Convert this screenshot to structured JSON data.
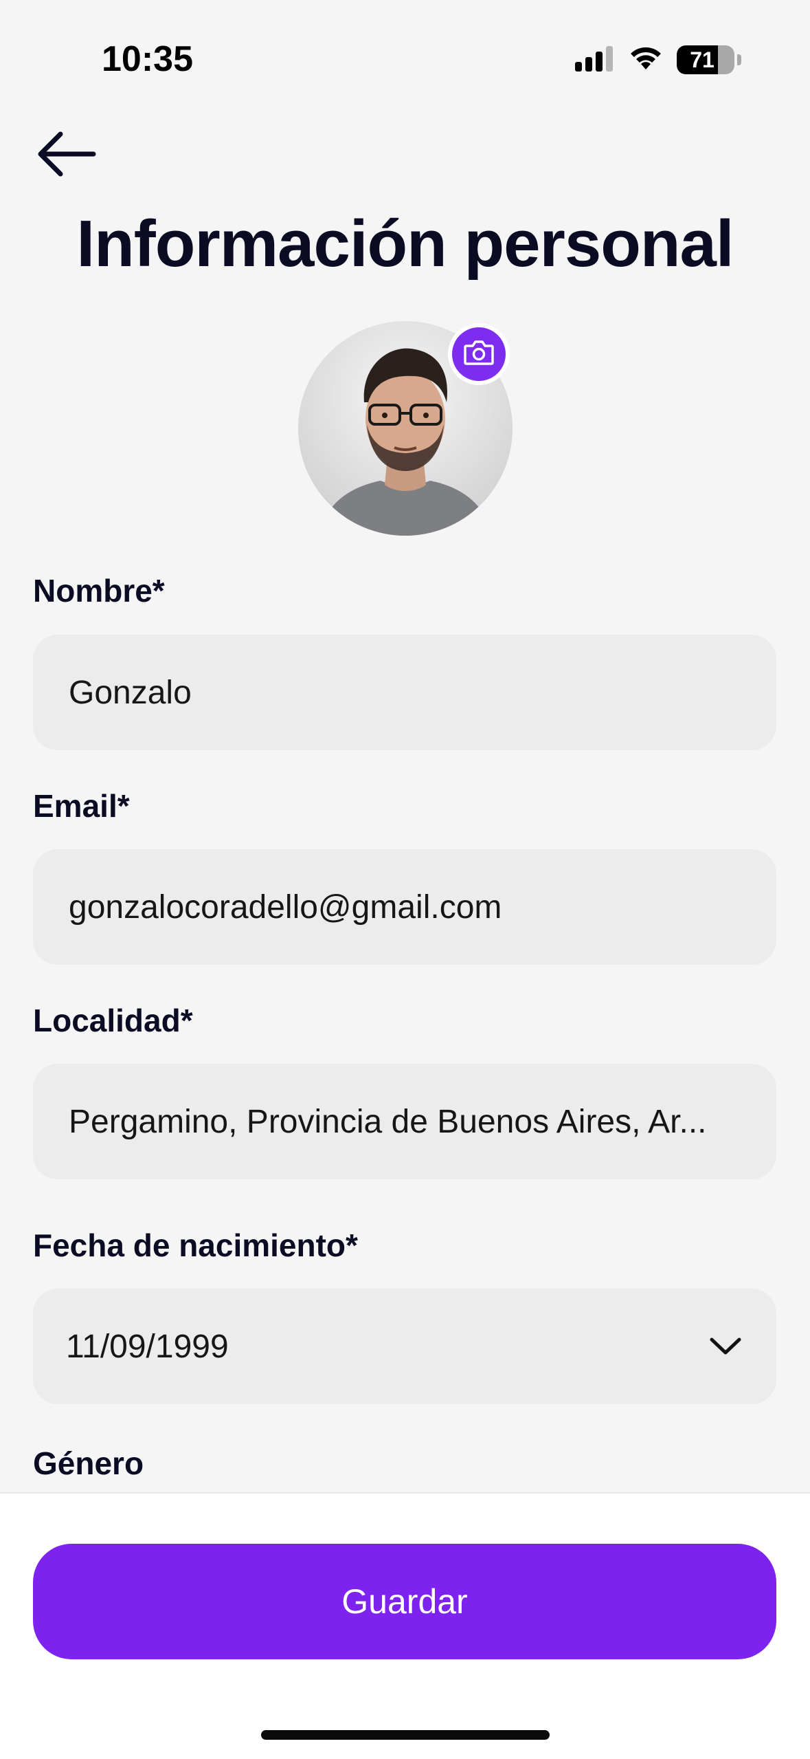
{
  "status_bar": {
    "time": "10:35",
    "battery_percent": "71",
    "battery_level": 0.71
  },
  "header": {
    "back_icon": "arrow-left-icon",
    "title": "Información personal"
  },
  "avatar": {
    "camera_icon": "camera-icon"
  },
  "form": {
    "name": {
      "label": "Nombre*",
      "value": "Gonzalo"
    },
    "email": {
      "label": "Email*",
      "value": "gonzalocoradello@gmail.com"
    },
    "location": {
      "label": "Localidad*",
      "value": "Pergamino, Provincia de Buenos Aires, Ar..."
    },
    "birthdate": {
      "label": "Fecha de nacimiento*",
      "value": "11/09/1999",
      "icon": "chevron-down-icon"
    },
    "gender": {
      "label": "Género"
    }
  },
  "footer": {
    "save_label": "Guardar"
  },
  "colors": {
    "accent": "#7e22f0",
    "background": "#f5f5f5",
    "input_bg": "#ececec",
    "text": "#0b0b24"
  }
}
